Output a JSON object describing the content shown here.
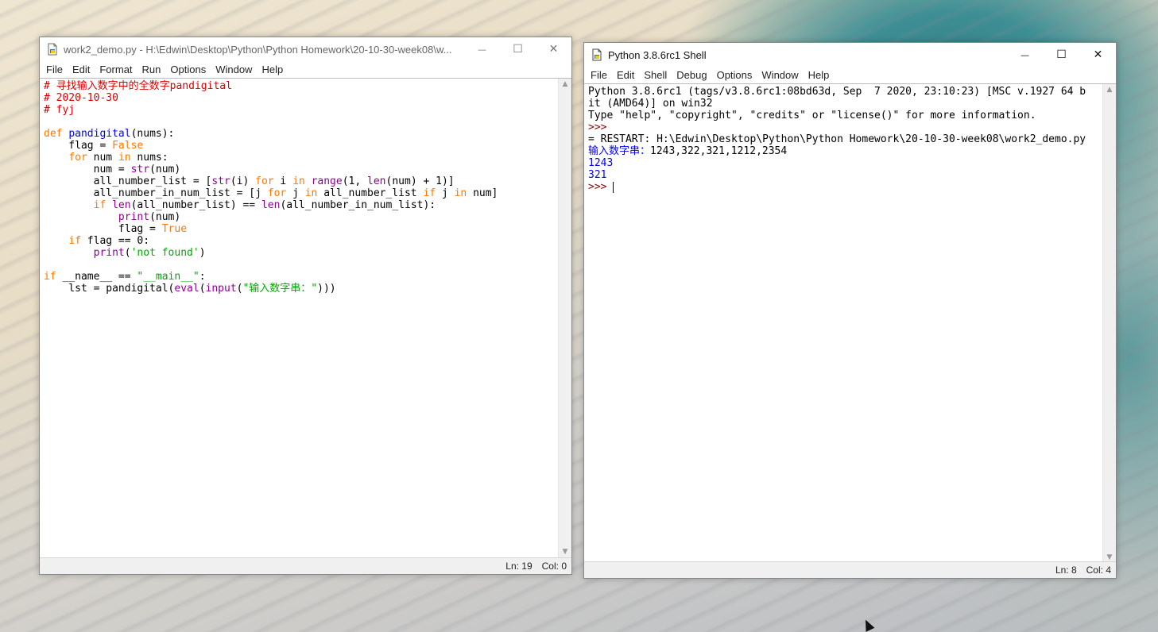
{
  "editor_window": {
    "title": "work2_demo.py - H:\\Edwin\\Desktop\\Python\\Python Homework\\20-10-30-week08\\w...",
    "icon": "python-file-icon",
    "menu": [
      "File",
      "Edit",
      "Format",
      "Run",
      "Options",
      "Window",
      "Help"
    ],
    "code_lines": [
      [
        {
          "t": "# 寻找输入数字中的全数字pandigital",
          "c": "c-comment"
        }
      ],
      [
        {
          "t": "# 2020-10-30",
          "c": "c-comment"
        }
      ],
      [
        {
          "t": "# fyj",
          "c": "c-comment"
        }
      ],
      [
        {
          "t": "",
          "c": ""
        }
      ],
      [
        {
          "t": "def",
          "c": "c-kw"
        },
        {
          "t": " ",
          "c": ""
        },
        {
          "t": "pandigital",
          "c": "c-def"
        },
        {
          "t": "(nums):",
          "c": ""
        }
      ],
      [
        {
          "t": "    flag = ",
          "c": ""
        },
        {
          "t": "False",
          "c": "c-kw"
        }
      ],
      [
        {
          "t": "    ",
          "c": ""
        },
        {
          "t": "for",
          "c": "c-kw"
        },
        {
          "t": " num ",
          "c": ""
        },
        {
          "t": "in",
          "c": "c-kw"
        },
        {
          "t": " nums:",
          "c": ""
        }
      ],
      [
        {
          "t": "        num = ",
          "c": ""
        },
        {
          "t": "str",
          "c": "c-builtin"
        },
        {
          "t": "(num)",
          "c": ""
        }
      ],
      [
        {
          "t": "        all_number_list = [",
          "c": ""
        },
        {
          "t": "str",
          "c": "c-builtin"
        },
        {
          "t": "(i) ",
          "c": ""
        },
        {
          "t": "for",
          "c": "c-kw"
        },
        {
          "t": " i ",
          "c": ""
        },
        {
          "t": "in",
          "c": "c-kw"
        },
        {
          "t": " ",
          "c": ""
        },
        {
          "t": "range",
          "c": "c-builtin"
        },
        {
          "t": "(1, ",
          "c": ""
        },
        {
          "t": "len",
          "c": "c-builtin"
        },
        {
          "t": "(num) + 1)]",
          "c": ""
        }
      ],
      [
        {
          "t": "        all_number_in_num_list = [j ",
          "c": ""
        },
        {
          "t": "for",
          "c": "c-kw"
        },
        {
          "t": " j ",
          "c": ""
        },
        {
          "t": "in",
          "c": "c-kw"
        },
        {
          "t": " all_number_list ",
          "c": ""
        },
        {
          "t": "if",
          "c": "c-kw"
        },
        {
          "t": " j ",
          "c": ""
        },
        {
          "t": "in",
          "c": "c-kw"
        },
        {
          "t": " num]",
          "c": ""
        }
      ],
      [
        {
          "t": "        ",
          "c": ""
        },
        {
          "t": "if",
          "c": "c-kw"
        },
        {
          "t": " ",
          "c": ""
        },
        {
          "t": "len",
          "c": "c-builtin"
        },
        {
          "t": "(all_number_list) == ",
          "c": ""
        },
        {
          "t": "len",
          "c": "c-builtin"
        },
        {
          "t": "(all_number_in_num_list):",
          "c": ""
        }
      ],
      [
        {
          "t": "            ",
          "c": ""
        },
        {
          "t": "print",
          "c": "c-builtin"
        },
        {
          "t": "(num)",
          "c": ""
        }
      ],
      [
        {
          "t": "            flag = ",
          "c": ""
        },
        {
          "t": "True",
          "c": "c-kw"
        }
      ],
      [
        {
          "t": "    ",
          "c": ""
        },
        {
          "t": "if",
          "c": "c-kw"
        },
        {
          "t": " flag == 0:",
          "c": ""
        }
      ],
      [
        {
          "t": "        ",
          "c": ""
        },
        {
          "t": "print",
          "c": "c-builtin"
        },
        {
          "t": "(",
          "c": ""
        },
        {
          "t": "'not found'",
          "c": "c-str"
        },
        {
          "t": ")",
          "c": ""
        }
      ],
      [
        {
          "t": "",
          "c": ""
        }
      ],
      [
        {
          "t": "if",
          "c": "c-kw"
        },
        {
          "t": " __name__ == ",
          "c": ""
        },
        {
          "t": "\"__main__\"",
          "c": "c-str"
        },
        {
          "t": ":",
          "c": ""
        }
      ],
      [
        {
          "t": "    lst = pandigital(",
          "c": ""
        },
        {
          "t": "eval",
          "c": "c-builtin"
        },
        {
          "t": "(",
          "c": ""
        },
        {
          "t": "input",
          "c": "c-builtin"
        },
        {
          "t": "(",
          "c": ""
        },
        {
          "t": "\"输入数字串：\"",
          "c": "c-str"
        },
        {
          "t": ")))",
          "c": ""
        }
      ]
    ],
    "status": {
      "ln": "Ln: 19",
      "col": "Col: 0"
    }
  },
  "shell_window": {
    "title": "Python 3.8.6rc1 Shell",
    "icon": "python-shell-icon",
    "menu": [
      "File",
      "Edit",
      "Shell",
      "Debug",
      "Options",
      "Window",
      "Help"
    ],
    "lines": [
      [
        {
          "t": "Python 3.8.6rc1 (tags/v3.8.6rc1:08bd63d, Sep  7 2020, 23:10:23) [MSC v.1927 64 b",
          "c": ""
        }
      ],
      [
        {
          "t": "it (AMD64)] on win32",
          "c": ""
        }
      ],
      [
        {
          "t": "Type \"help\", \"copyright\", \"credits\" or \"license()\" for more information.",
          "c": ""
        }
      ],
      [
        {
          "t": ">>>",
          "c": "c-prompt"
        }
      ],
      [
        {
          "t": "= RESTART: H:\\Edwin\\Desktop\\Python\\Python Homework\\20-10-30-week08\\work2_demo.py",
          "c": ""
        }
      ],
      [
        {
          "t": "输入数字串：",
          "c": "c-stdout"
        },
        {
          "t": "1243,322,321,1212,2354",
          "c": ""
        }
      ],
      [
        {
          "t": "1243",
          "c": "c-stdout"
        }
      ],
      [
        {
          "t": "321",
          "c": "c-stdout"
        }
      ]
    ],
    "prompt": ">>> ",
    "status": {
      "ln": "Ln: 8",
      "col": "Col: 4"
    }
  },
  "title_buttons": {
    "minimize": "—",
    "maximize": "☐",
    "close": "✕"
  }
}
